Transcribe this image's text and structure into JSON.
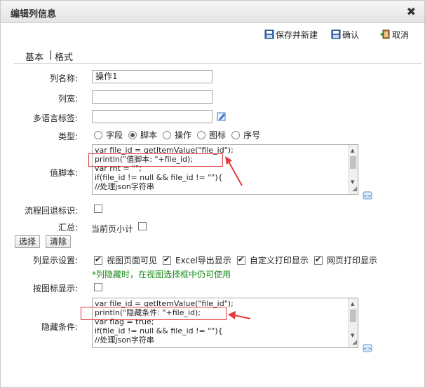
{
  "window": {
    "title": "编辑列信息",
    "close_label": "✖"
  },
  "toolbar": {
    "save_new": "保存并新建",
    "confirm": "确认",
    "cancel": "取消"
  },
  "tabs": {
    "basic": "基本",
    "separator": "|",
    "format": "格式"
  },
  "form": {
    "col_name_label": "列名称:",
    "col_name_value": "操作1",
    "col_width_label": "列宽:",
    "col_width_value": "",
    "i18n_label": "多语言标签:",
    "i18n_value": "",
    "type_label": "类型:",
    "type_options": [
      "字段",
      "脚本",
      "操作",
      "图标",
      "序号"
    ],
    "type_selected": "脚本",
    "value_script_label": "值脚本:",
    "value_script_lines": [
      "var file_id = getItemValue(\"file_id\");",
      "println(\"值脚本: \"+file_id);",
      "var rnt = \"\";",
      "if(file_id != null && file_id != \"\"){",
      "        //处理json字符串"
    ],
    "flow_back_label": "流程回退标识:",
    "summary_label": "汇总:",
    "summary_option": "当前页小计",
    "select_button": "选择",
    "clear_button": "清除",
    "display_label": "列显示设置:",
    "display_options": [
      {
        "label": "视图页面可见",
        "checked": true
      },
      {
        "label": "Excel导出显示",
        "checked": true
      },
      {
        "label": "自定义打印显示",
        "checked": true
      },
      {
        "label": "网页打印显示",
        "checked": true
      }
    ],
    "hidden_note": "*列隐藏时，在视图选择框中仍可使用",
    "icon_display_label": "按图标显示:",
    "hide_condition_label": "隐藏条件:",
    "hide_condition_lines": [
      "var file_id = getItemValue(\"file_id\");",
      "println(\"隐藏条件: \"+file_id);",
      "var flag = true;",
      "if(file_id != null && file_id != \"\"){",
      "        //处理json字符串"
    ]
  },
  "colors": {
    "highlight": "#e23b3b",
    "note": "#1a8a1a"
  }
}
